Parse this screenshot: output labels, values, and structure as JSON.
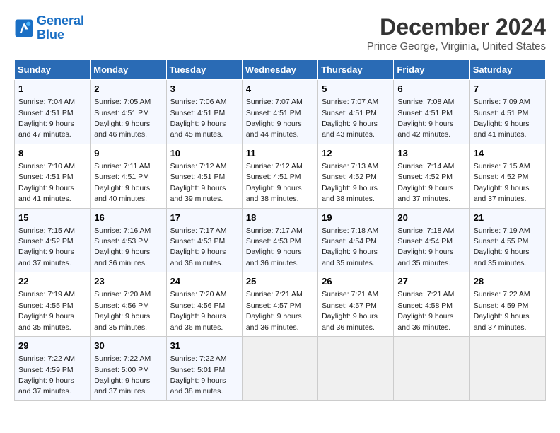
{
  "logo": {
    "line1": "General",
    "line2": "Blue"
  },
  "title": "December 2024",
  "subtitle": "Prince George, Virginia, United States",
  "days_of_week": [
    "Sunday",
    "Monday",
    "Tuesday",
    "Wednesday",
    "Thursday",
    "Friday",
    "Saturday"
  ],
  "weeks": [
    [
      {
        "num": "1",
        "rise": "7:04 AM",
        "set": "4:51 PM",
        "daylight": "9 hours and 47 minutes."
      },
      {
        "num": "2",
        "rise": "7:05 AM",
        "set": "4:51 PM",
        "daylight": "9 hours and 46 minutes."
      },
      {
        "num": "3",
        "rise": "7:06 AM",
        "set": "4:51 PM",
        "daylight": "9 hours and 45 minutes."
      },
      {
        "num": "4",
        "rise": "7:07 AM",
        "set": "4:51 PM",
        "daylight": "9 hours and 44 minutes."
      },
      {
        "num": "5",
        "rise": "7:07 AM",
        "set": "4:51 PM",
        "daylight": "9 hours and 43 minutes."
      },
      {
        "num": "6",
        "rise": "7:08 AM",
        "set": "4:51 PM",
        "daylight": "9 hours and 42 minutes."
      },
      {
        "num": "7",
        "rise": "7:09 AM",
        "set": "4:51 PM",
        "daylight": "9 hours and 41 minutes."
      }
    ],
    [
      {
        "num": "8",
        "rise": "7:10 AM",
        "set": "4:51 PM",
        "daylight": "9 hours and 41 minutes."
      },
      {
        "num": "9",
        "rise": "7:11 AM",
        "set": "4:51 PM",
        "daylight": "9 hours and 40 minutes."
      },
      {
        "num": "10",
        "rise": "7:12 AM",
        "set": "4:51 PM",
        "daylight": "9 hours and 39 minutes."
      },
      {
        "num": "11",
        "rise": "7:12 AM",
        "set": "4:51 PM",
        "daylight": "9 hours and 38 minutes."
      },
      {
        "num": "12",
        "rise": "7:13 AM",
        "set": "4:52 PM",
        "daylight": "9 hours and 38 minutes."
      },
      {
        "num": "13",
        "rise": "7:14 AM",
        "set": "4:52 PM",
        "daylight": "9 hours and 37 minutes."
      },
      {
        "num": "14",
        "rise": "7:15 AM",
        "set": "4:52 PM",
        "daylight": "9 hours and 37 minutes."
      }
    ],
    [
      {
        "num": "15",
        "rise": "7:15 AM",
        "set": "4:52 PM",
        "daylight": "9 hours and 37 minutes."
      },
      {
        "num": "16",
        "rise": "7:16 AM",
        "set": "4:53 PM",
        "daylight": "9 hours and 36 minutes."
      },
      {
        "num": "17",
        "rise": "7:17 AM",
        "set": "4:53 PM",
        "daylight": "9 hours and 36 minutes."
      },
      {
        "num": "18",
        "rise": "7:17 AM",
        "set": "4:53 PM",
        "daylight": "9 hours and 36 minutes."
      },
      {
        "num": "19",
        "rise": "7:18 AM",
        "set": "4:54 PM",
        "daylight": "9 hours and 35 minutes."
      },
      {
        "num": "20",
        "rise": "7:18 AM",
        "set": "4:54 PM",
        "daylight": "9 hours and 35 minutes."
      },
      {
        "num": "21",
        "rise": "7:19 AM",
        "set": "4:55 PM",
        "daylight": "9 hours and 35 minutes."
      }
    ],
    [
      {
        "num": "22",
        "rise": "7:19 AM",
        "set": "4:55 PM",
        "daylight": "9 hours and 35 minutes."
      },
      {
        "num": "23",
        "rise": "7:20 AM",
        "set": "4:56 PM",
        "daylight": "9 hours and 35 minutes."
      },
      {
        "num": "24",
        "rise": "7:20 AM",
        "set": "4:56 PM",
        "daylight": "9 hours and 36 minutes."
      },
      {
        "num": "25",
        "rise": "7:21 AM",
        "set": "4:57 PM",
        "daylight": "9 hours and 36 minutes."
      },
      {
        "num": "26",
        "rise": "7:21 AM",
        "set": "4:57 PM",
        "daylight": "9 hours and 36 minutes."
      },
      {
        "num": "27",
        "rise": "7:21 AM",
        "set": "4:58 PM",
        "daylight": "9 hours and 36 minutes."
      },
      {
        "num": "28",
        "rise": "7:22 AM",
        "set": "4:59 PM",
        "daylight": "9 hours and 37 minutes."
      }
    ],
    [
      {
        "num": "29",
        "rise": "7:22 AM",
        "set": "4:59 PM",
        "daylight": "9 hours and 37 minutes."
      },
      {
        "num": "30",
        "rise": "7:22 AM",
        "set": "5:00 PM",
        "daylight": "9 hours and 37 minutes."
      },
      {
        "num": "31",
        "rise": "7:22 AM",
        "set": "5:01 PM",
        "daylight": "9 hours and 38 minutes."
      },
      null,
      null,
      null,
      null
    ]
  ]
}
